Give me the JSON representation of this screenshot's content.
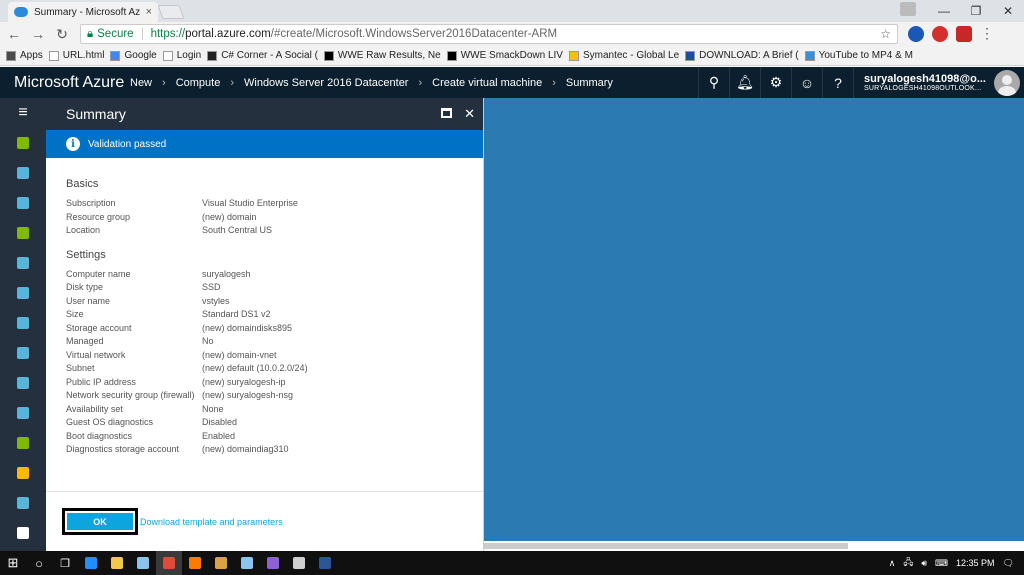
{
  "browser": {
    "tab_title": "Summary - Microsoft Az",
    "tab_close": "×",
    "url_secure_label": "Secure",
    "url_scheme": "https://",
    "url_host": "portal.azure.com",
    "url_path": "/#create/Microsoft.WindowsServer2016Datacenter-ARM"
  },
  "bookmarks": [
    {
      "label": "Apps",
      "color": "#4a4a4a"
    },
    {
      "label": "URL.html",
      "color": "#ffffff"
    },
    {
      "label": "Google",
      "color": "#4285f4"
    },
    {
      "label": "Login",
      "color": "#ffffff"
    },
    {
      "label": "C# Corner - A Social (",
      "color": "#222222"
    },
    {
      "label": "WWE Raw Results, Ne",
      "color": "#000000"
    },
    {
      "label": "WWE SmackDown LIV",
      "color": "#000000"
    },
    {
      "label": "Symantec - Global Le",
      "color": "#f4c20d"
    },
    {
      "label": "DOWNLOAD: A Brief (",
      "color": "#1a4fa0"
    },
    {
      "label": "YouTube to MP4 & M",
      "color": "#3a8fd6"
    }
  ],
  "header": {
    "brand": "Microsoft Azure",
    "breadcrumb": [
      "New",
      "Compute",
      "Windows Server 2016 Datacenter",
      "Create virtual machine",
      "Summary"
    ],
    "user_name": "suryalogesh41098@o...",
    "user_email": "SURYALOGESH41098OUTLOOK..."
  },
  "blade": {
    "title": "Summary",
    "validation": "Validation passed",
    "sections": [
      {
        "title": "Basics",
        "rows": [
          {
            "k": "Subscription",
            "v": "Visual Studio Enterprise"
          },
          {
            "k": "Resource group",
            "v": "(new) domain"
          },
          {
            "k": "Location",
            "v": "South Central US"
          }
        ]
      },
      {
        "title": "Settings",
        "rows": [
          {
            "k": "Computer name",
            "v": "suryalogesh"
          },
          {
            "k": "Disk type",
            "v": "SSD"
          },
          {
            "k": "User name",
            "v": "vstyles"
          },
          {
            "k": "Size",
            "v": "Standard DS1 v2"
          },
          {
            "k": "Storage account",
            "v": "(new) domaindisks895"
          },
          {
            "k": "Managed",
            "v": "No"
          },
          {
            "k": "Virtual network",
            "v": "(new) domain-vnet"
          },
          {
            "k": "Subnet",
            "v": "(new) default (10.0.2.0/24)"
          },
          {
            "k": "Public IP address",
            "v": "(new) suryalogesh-ip"
          },
          {
            "k": "Network security group (firewall)",
            "v": "(new) suryalogesh-nsg"
          },
          {
            "k": "Availability set",
            "v": "None"
          },
          {
            "k": "Guest OS diagnostics",
            "v": "Disabled"
          },
          {
            "k": "Boot diagnostics",
            "v": "Enabled"
          },
          {
            "k": "Diagnostics storage account",
            "v": "(new) domaindiag310"
          }
        ]
      }
    ],
    "ok_label": "OK",
    "download_label": "Download template and parameters"
  },
  "nav_icons": [
    {
      "name": "create-resource-icon",
      "color": "#7fba00"
    },
    {
      "name": "dashboard-icon",
      "color": "#59b4d9"
    },
    {
      "name": "resource-groups-icon",
      "color": "#59b4d9"
    },
    {
      "name": "all-resources-icon",
      "color": "#7fba00"
    },
    {
      "name": "recent-icon",
      "color": "#59b4d9"
    },
    {
      "name": "app-services-icon",
      "color": "#59b4d9"
    },
    {
      "name": "virtual-machines-icon",
      "color": "#59b4d9"
    },
    {
      "name": "cloud-services-icon",
      "color": "#59b4d9"
    },
    {
      "name": "sql-databases-icon",
      "color": "#59b4d9"
    },
    {
      "name": "cosmos-db-icon",
      "color": "#59b4d9"
    },
    {
      "name": "security-center-icon",
      "color": "#7fba00"
    },
    {
      "name": "key-vault-icon",
      "color": "#ffb900"
    },
    {
      "name": "marketplace-icon",
      "color": "#59b4d9"
    },
    {
      "name": "monitor-icon",
      "color": "#ffffff"
    }
  ],
  "taskbar": {
    "time": "12:35 PM",
    "apps": [
      {
        "name": "edge-icon",
        "color": "#1e90ff"
      },
      {
        "name": "file-explorer-icon",
        "color": "#f2c94c"
      },
      {
        "name": "server-manager-icon",
        "color": "#8bc4ea"
      },
      {
        "name": "chrome-icon",
        "color": "#e5493a"
      },
      {
        "name": "firefox-icon",
        "color": "#ff7a00"
      },
      {
        "name": "winrar-icon",
        "color": "#d9a441"
      },
      {
        "name": "azure-storage-icon",
        "color": "#8cc6ef"
      },
      {
        "name": "visual-studio-icon",
        "color": "#8f5fd6"
      },
      {
        "name": "notepad-icon",
        "color": "#d0d0d0"
      },
      {
        "name": "word-icon",
        "color": "#2b5797"
      }
    ]
  },
  "colors": {
    "azure_header": "#0b1f2e",
    "validation_bar": "#0072c6",
    "ok_button": "#0ea5df",
    "background": "#2b7ab2"
  }
}
